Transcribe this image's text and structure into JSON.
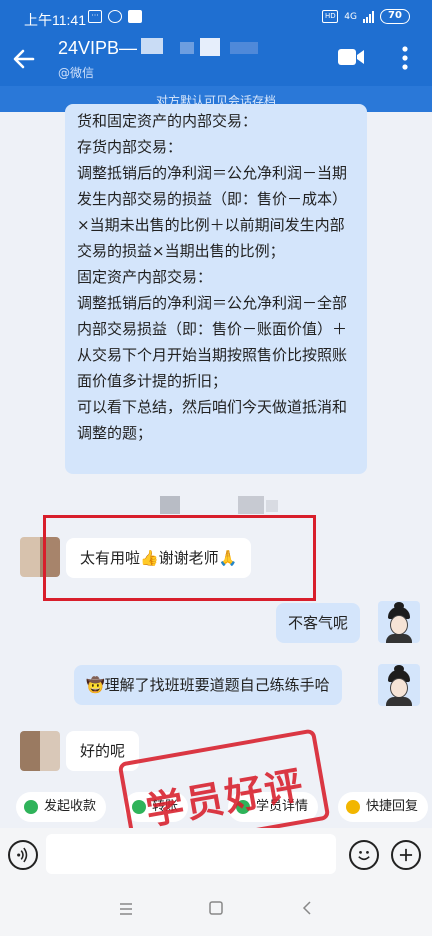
{
  "status_bar": {
    "time": "上午11:41",
    "battery": "70",
    "network": "4G"
  },
  "header": {
    "title": "24VIPB—",
    "subtitle": "@微信",
    "notice": "对方默认可见会话存档"
  },
  "messages": {
    "teacher_long": {
      "lines": [
        "货和固定资产的内部交易：",
        "存货内部交易：",
        "调整抵销后的净利润＝公允净利润－当期发生内部交易的损益（即：售价－成本）×当期未出售的比例＋以前期间发生内部交易的损益×当期出售的比例；",
        "固定资产内部交易：",
        "调整抵销后的净利润＝公允净利润－全部内部交易损益（即：售价－账面价值）＋从交易下个月开始当期按照售价比按照账面价值多计提的折旧；",
        "可以看下总结，然后咱们今天做道抵消和调整的题；"
      ]
    },
    "student_thanks": "太有用啦👍谢谢老师🙏",
    "teacher_reply": "不客气呢",
    "teacher_note": "🤠理解了找班班要道题自己练练手哈",
    "student_ok": "好的呢"
  },
  "quick_actions": {
    "collect": "发起收款",
    "transfer": "转账",
    "student_detail": "学员详情",
    "quick_reply": "快捷回复"
  },
  "stamp": {
    "text": "学员好评"
  },
  "colors": {
    "header": "#1f6fd1",
    "teacher_bubble": "#d4e5fb",
    "highlight": "#d81e2b"
  }
}
